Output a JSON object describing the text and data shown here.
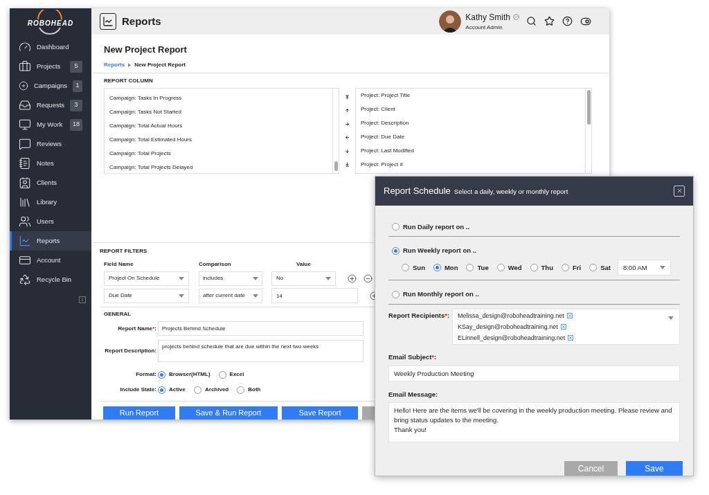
{
  "sidebar": {
    "logo": "ROBOHEAD",
    "items": [
      {
        "label": "Dashboard",
        "selected": false
      },
      {
        "label": "Projects",
        "badge": "5",
        "selected": false
      },
      {
        "label": "Campaigns",
        "badge": "1",
        "selected": false
      },
      {
        "label": "Requests",
        "badge": "3",
        "selected": false
      },
      {
        "label": "My Work",
        "badge": "18",
        "selected": false
      },
      {
        "label": "Reviews",
        "selected": false
      },
      {
        "label": "Notes",
        "selected": false
      },
      {
        "label": "Clients",
        "selected": false
      },
      {
        "label": "Library",
        "selected": false
      },
      {
        "label": "Users",
        "selected": false
      },
      {
        "label": "Reports",
        "selected": true
      },
      {
        "label": "Account",
        "selected": false
      },
      {
        "label": "Recycle Bin",
        "selected": false
      }
    ]
  },
  "header": {
    "title": "Reports",
    "user": {
      "name": "Kathy Smith",
      "role": "Account Admin"
    }
  },
  "page": {
    "title": "New Project Report",
    "breadcrumb": [
      "Reports",
      "New Project Report"
    ]
  },
  "report_column": {
    "heading": "REPORT COLUMN",
    "available": [
      "Campaign: Tasks In Progress",
      "Campaign: Tasks Not Started",
      "Campaign: Total Actual Hours",
      "Campaign: Total Estimated Hours",
      "Campaign: Total Projects",
      "Campaign: Total Projects Delayed"
    ],
    "chosen": [
      "Project: Project Title",
      "Project: Client",
      "Project: Description",
      "Project: Due Date",
      "Project: Last Modified",
      "Project: Project #"
    ]
  },
  "filters": {
    "heading": "REPORT FILTERS",
    "columns": [
      "Field Name",
      "Comparison",
      "Value"
    ],
    "rows": [
      {
        "field": "Project On Schedule",
        "comparison": "includes",
        "value": "No",
        "kind": "select",
        "removable": true
      },
      {
        "field": "Due Date",
        "comparison": "after current date",
        "value": "14",
        "kind": "input"
      }
    ]
  },
  "general": {
    "heading": "GENERAL",
    "name": {
      "label": "Report Name",
      "required_mark": "*",
      "suffix": ":",
      "value": "Projects Behind Schedule"
    },
    "description": {
      "label": "Report Description:",
      "value": "projects behind schedule that are due within the next two weeks"
    },
    "format": {
      "label": "Format:",
      "options": [
        {
          "label": "Browser(HTML)",
          "selected": true
        },
        {
          "label": "Excel",
          "selected": false
        }
      ]
    },
    "include_state": {
      "label": "Include State:",
      "options": [
        {
          "label": "Active",
          "selected": true
        },
        {
          "label": "Archived",
          "selected": false
        },
        {
          "label": "Both",
          "selected": false
        }
      ]
    }
  },
  "actions": [
    {
      "label": "Run Report",
      "kind": "primary"
    },
    {
      "label": "Save & Run Report",
      "kind": "primary"
    },
    {
      "label": "Save Report",
      "kind": "primary"
    },
    {
      "kind": "secondary"
    }
  ],
  "dialog": {
    "title": "Report Schedule",
    "subtitle": "Select a daily, weekly or monthly report",
    "schedules": [
      {
        "label": "Run Daily report on ..",
        "selected": false
      },
      {
        "label": "Run Weekly report on ..",
        "selected": true,
        "days": [
          {
            "label": "Sun",
            "selected": false
          },
          {
            "label": "Mon",
            "selected": true
          },
          {
            "label": "Tue",
            "selected": false
          },
          {
            "label": "Wed",
            "selected": false
          },
          {
            "label": "Thu",
            "selected": false
          },
          {
            "label": "Fri",
            "selected": false
          },
          {
            "label": "Sat",
            "selected": false
          }
        ],
        "time": "8:00 AM"
      },
      {
        "label": "Run Monthly report on ..",
        "selected": false
      }
    ],
    "recipients": {
      "label": "Report Recipients",
      "required_mark": "*",
      "suffix": ":",
      "emails": [
        "Melissa_design@roboheadtraining.net",
        "KSay_design@roboheadtraining.net",
        "ELinnell_design@roboheadtraining.net"
      ]
    },
    "subject": {
      "label": "Email Subject",
      "required_mark": "*",
      "suffix": ":",
      "value": "Weekly Production Meeting"
    },
    "message": {
      "label": "Email Message:",
      "lines": [
        "Hello! Here are the items we'll be covering in the weekly production meeting. Please review and bring status updates to the meeting.",
        "Thank you!"
      ]
    },
    "buttons": [
      {
        "label": "Cancel",
        "kind": "secondary"
      },
      {
        "label": "Save",
        "kind": "primary"
      }
    ]
  }
}
